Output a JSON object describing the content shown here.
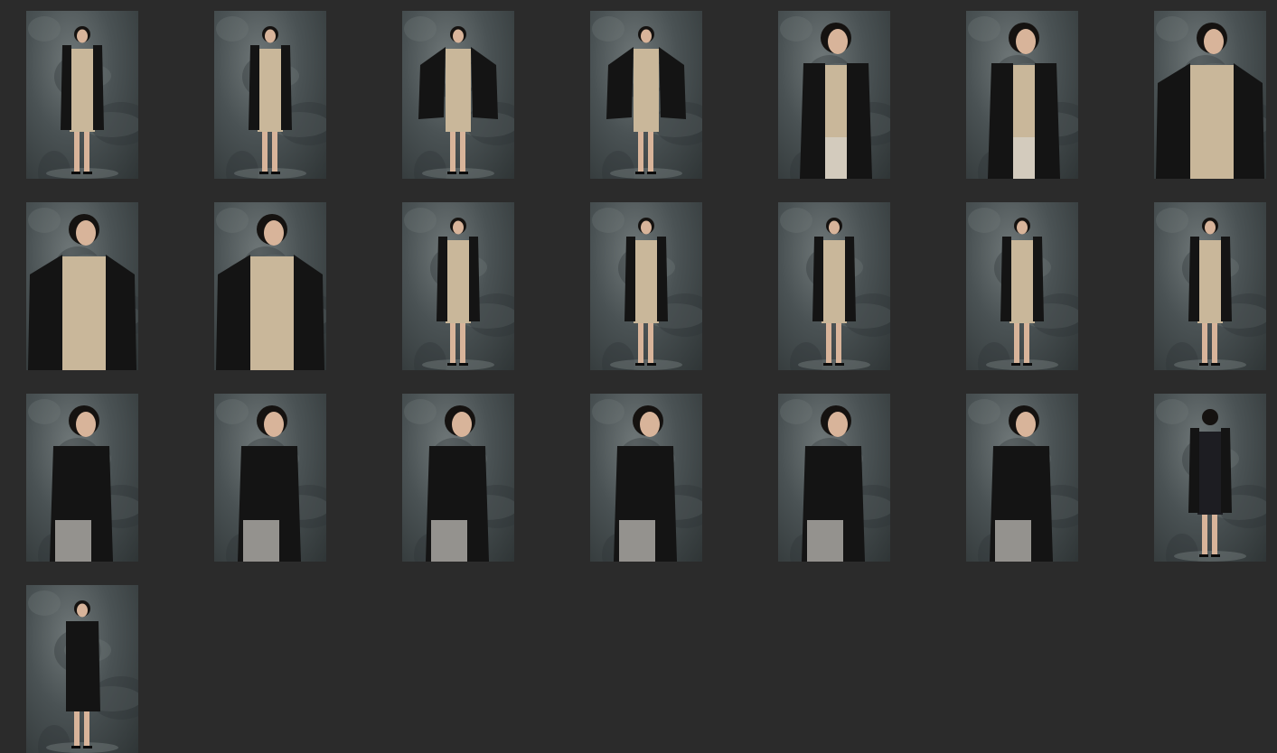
{
  "gallery": {
    "background": "#2b2b2b",
    "columns": 7,
    "photos": [
      {
        "pose": "front-full-coat-closed",
        "scale": "full"
      },
      {
        "pose": "front-full-coat-closed",
        "scale": "full"
      },
      {
        "pose": "front-full-coat-open",
        "scale": "full"
      },
      {
        "pose": "front-full-coat-open",
        "scale": "full"
      },
      {
        "pose": "front-half-coat-closed",
        "scale": "half"
      },
      {
        "pose": "front-half-coat-closed",
        "scale": "half"
      },
      {
        "pose": "front-half-coat-open-head-down",
        "scale": "half"
      },
      {
        "pose": "front-half-coat-open",
        "scale": "half"
      },
      {
        "pose": "front-half-coat-open",
        "scale": "half"
      },
      {
        "pose": "front-full-walking",
        "scale": "full"
      },
      {
        "pose": "front-full-walking",
        "scale": "full"
      },
      {
        "pose": "front-full-walking",
        "scale": "full"
      },
      {
        "pose": "front-full-arms-out",
        "scale": "full"
      },
      {
        "pose": "front-full-arms-out",
        "scale": "full"
      },
      {
        "pose": "side-half",
        "scale": "half"
      },
      {
        "pose": "side-half-arms-crossed",
        "scale": "half"
      },
      {
        "pose": "side-half-arms-crossed",
        "scale": "half"
      },
      {
        "pose": "side-half-arms-crossed",
        "scale": "half"
      },
      {
        "pose": "side-half-looking-up",
        "scale": "half"
      },
      {
        "pose": "side-half-arms-crossed",
        "scale": "half"
      },
      {
        "pose": "back-full",
        "scale": "full"
      },
      {
        "pose": "side-full",
        "scale": "full"
      }
    ],
    "colors": {
      "backdrop_light": "#6f7778",
      "backdrop_dark": "#2f3536",
      "coat": "#141414",
      "dress": "#c9b79a",
      "pattern": "#1d1d22",
      "skin": "#d8b49a",
      "hair": "#151210"
    }
  }
}
